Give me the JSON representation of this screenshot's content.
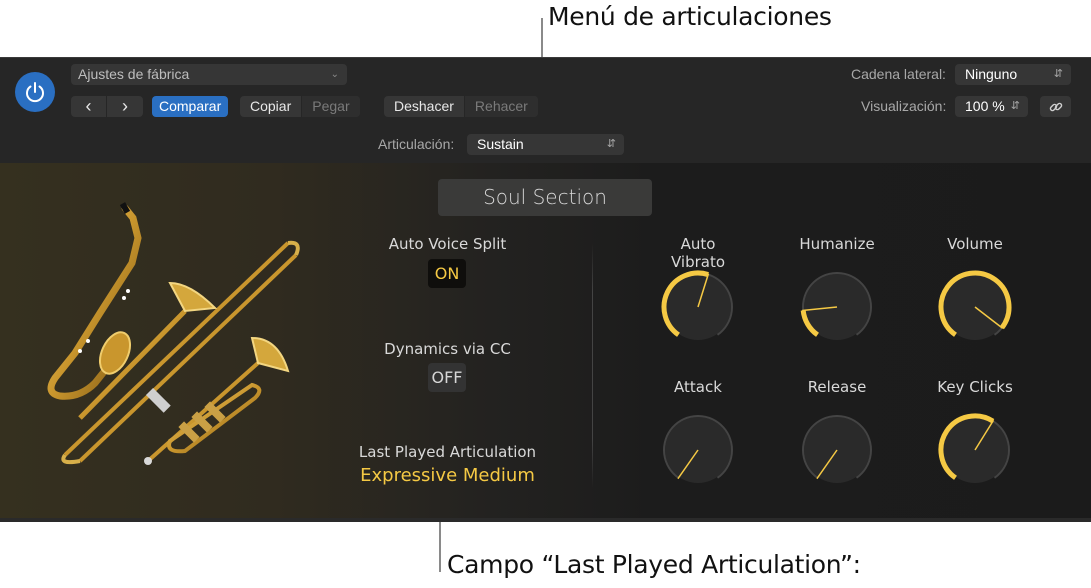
{
  "callouts": {
    "top": "Menú de articulaciones",
    "bottom": "Campo “Last Played Articulation”:"
  },
  "header": {
    "preset": "Ajustes de fábrica",
    "nav_prev": "‹",
    "nav_next": "›",
    "compare": "Comparar",
    "copy": "Copiar",
    "paste": "Pegar",
    "undo": "Deshacer",
    "redo": "Rehacer",
    "articulation_label": "Articulación:",
    "articulation_value": "Sustain",
    "sidechain_label": "Cadena lateral:",
    "sidechain_value": "Ninguno",
    "view_label": "Visualización:",
    "view_value": "100 %"
  },
  "colors": {
    "accent_blue": "#2a6fc2",
    "knob_gold": "#f5c944"
  },
  "instrument": {
    "title": "Soul Section",
    "image": "saxophone-trombone-trumpet"
  },
  "switches": [
    {
      "label": "Auto Voice Split",
      "state": "ON"
    },
    {
      "label": "Dynamics via CC",
      "state": "OFF"
    }
  ],
  "last_played": {
    "label": "Last Played Articulation",
    "value": "Expressive Medium"
  },
  "knobs": [
    {
      "label": "Auto Vibrato",
      "value": 0.56
    },
    {
      "label": "Humanize",
      "value": 0.17
    },
    {
      "label": "Volume",
      "value": 0.94
    },
    {
      "label": "Attack",
      "value": 0.0
    },
    {
      "label": "Release",
      "value": 0.0
    },
    {
      "label": "Key Clicks",
      "value": 0.61
    }
  ]
}
